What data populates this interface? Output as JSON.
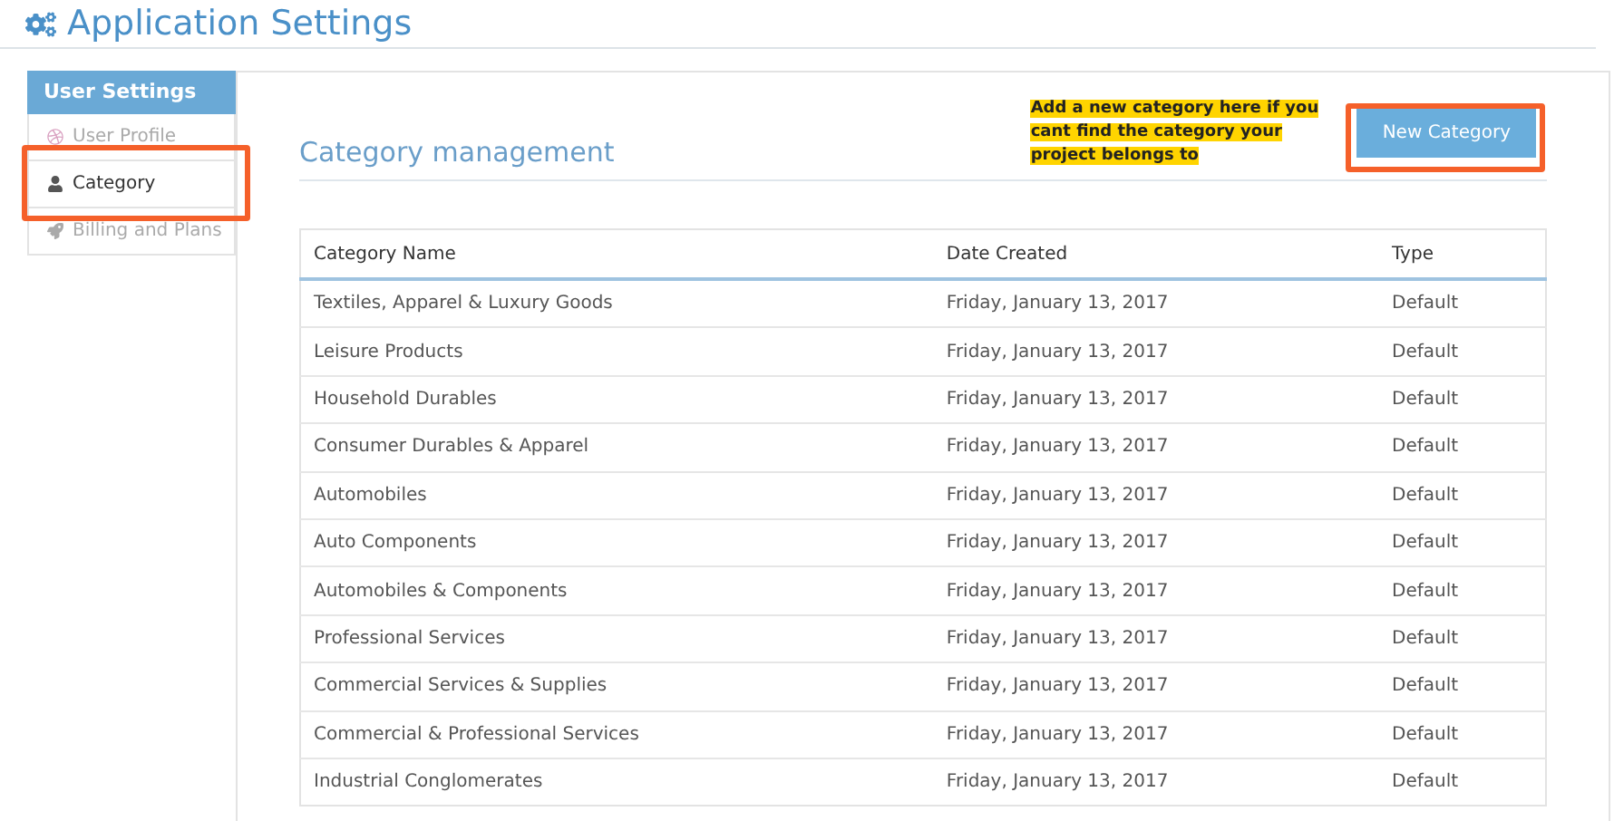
{
  "page_title": "Application Settings",
  "sidebar": {
    "heading": "User Settings",
    "items": [
      {
        "label": "User Profile",
        "selected": false
      },
      {
        "label": "Category",
        "selected": true
      },
      {
        "label": "Billing and Plans",
        "selected": false
      }
    ]
  },
  "section_title": "Category management",
  "callout": "Add a new category here if you cant find the category your project belongs to",
  "new_button": "New Category",
  "table": {
    "columns": [
      "Category Name",
      "Date Created",
      "Type"
    ],
    "rows": [
      [
        "Textiles, Apparel & Luxury Goods",
        "Friday, January 13, 2017",
        "Default"
      ],
      [
        "Leisure Products",
        "Friday, January 13, 2017",
        "Default"
      ],
      [
        "Household Durables",
        "Friday, January 13, 2017",
        "Default"
      ],
      [
        "Consumer Durables & Apparel",
        "Friday, January 13, 2017",
        "Default"
      ],
      [
        "Automobiles",
        "Friday, January 13, 2017",
        "Default"
      ],
      [
        "Auto Components",
        "Friday, January 13, 2017",
        "Default"
      ],
      [
        "Automobiles & Components",
        "Friday, January 13, 2017",
        "Default"
      ],
      [
        "Professional Services",
        "Friday, January 13, 2017",
        "Default"
      ],
      [
        "Commercial Services & Supplies",
        "Friday, January 13, 2017",
        "Default"
      ],
      [
        "Commercial & Professional Services",
        "Friday, January 13, 2017",
        "Default"
      ],
      [
        "Industrial Conglomerates",
        "Friday, January 13, 2017",
        "Default"
      ]
    ]
  }
}
